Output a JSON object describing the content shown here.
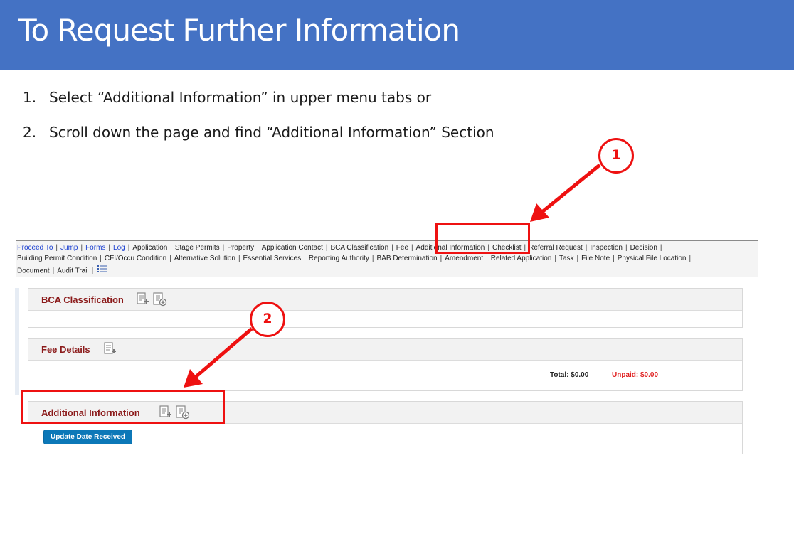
{
  "slide": {
    "title": "To Request Further Information",
    "steps": [
      {
        "num": "1.",
        "text": "Select “Additional Information” in upper menu tabs or"
      },
      {
        "num": "2.",
        "text": "Scroll down the page and find “Additional Information” Section"
      }
    ]
  },
  "menu": {
    "line1_links": [
      "Proceed To",
      "Jump",
      "Forms",
      "Log"
    ],
    "line1_items": [
      "Application",
      "Stage Permits",
      "Property",
      "Application Contact",
      "BCA Classification",
      "Fee",
      "Additional Information",
      "Checklist",
      "Referral Request",
      "Inspection",
      "Decision"
    ],
    "line2_items": [
      "Building Permit Condition",
      "CFI/Occu Condition",
      "Alternative Solution",
      "Essential Services",
      "Reporting Authority",
      "BAB Determination",
      "Amendment",
      "Related Application",
      "Task",
      "File Note",
      "Physical File Location"
    ],
    "line3_items": [
      "Document",
      "Audit Trail"
    ]
  },
  "panels": {
    "bca": {
      "title": "BCA Classification"
    },
    "fee": {
      "title": "Fee Details",
      "total": "Total: $0.00",
      "unpaid": "Unpaid: $0.00"
    },
    "additional": {
      "title": "Additional Information",
      "button": "Update Date Received"
    }
  },
  "annotations": {
    "callout_1": "1",
    "callout_2": "2"
  },
  "colors": {
    "header_bg": "#4472c4",
    "panel_title": "#8b1a1a",
    "link": "#1a3fd0",
    "highlight": "#ee1111",
    "button": "#0c78b8",
    "unpaid": "#e02020"
  },
  "icons": [
    "document-add-icon",
    "list-add-icon",
    "list-icon"
  ]
}
